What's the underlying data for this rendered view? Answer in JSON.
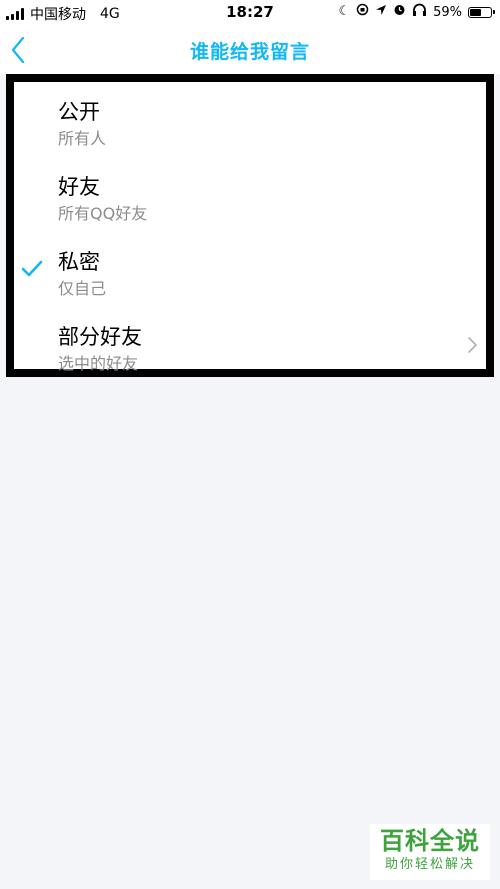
{
  "status_bar": {
    "carrier": "中国移动",
    "network": "4G",
    "time": "18:27",
    "battery_percent": "59%",
    "battery_level": 0.59,
    "icons": [
      "moon-icon",
      "rotation-lock-icon",
      "location-icon",
      "alarm-icon",
      "headphones-icon",
      "battery-icon"
    ]
  },
  "nav": {
    "title": "谁能给我留言",
    "back_icon": "chevron-left-icon"
  },
  "options": [
    {
      "title": "公开",
      "subtitle": "所有人",
      "selected": false,
      "has_chevron": false
    },
    {
      "title": "好友",
      "subtitle": "所有QQ好友",
      "selected": false,
      "has_chevron": false
    },
    {
      "title": "私密",
      "subtitle": "仅自己",
      "selected": true,
      "has_chevron": false
    },
    {
      "title": "部分好友",
      "subtitle": "选中的好友",
      "selected": false,
      "has_chevron": true
    }
  ],
  "watermark": {
    "main": "百科全说",
    "sub": "助你轻松解决"
  },
  "colors": {
    "accent": "#12b7f5",
    "watermark": "#3fa33d",
    "subtitle": "#8c8c8c",
    "background": "#f4f5f9"
  }
}
